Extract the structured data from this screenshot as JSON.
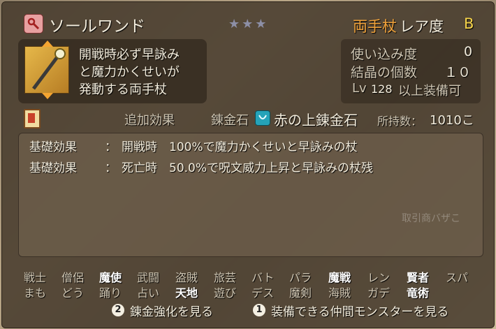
{
  "item": {
    "name": "ソールワンド",
    "stars": "★★★",
    "type": "両手杖",
    "rarity_label": "レア度",
    "rarity": "B",
    "description_lines": [
      "開戦時必ず早詠み",
      "と魔力かくせいが",
      "発動する両手杖"
    ]
  },
  "stats": {
    "usage_label": "使い込み度",
    "usage_value": "0",
    "crystal_label": "結晶の個数",
    "crystal_value": "１０",
    "lv_prefix": "Lv",
    "lv_value": "128",
    "lv_suffix": "以上装備可"
  },
  "extra": {
    "tab_label": "追加効果",
    "stone_label": "錬金石",
    "stone_name": "赤の上錬金石",
    "owned_label": "所持数：",
    "owned_value": "1010こ"
  },
  "effects": [
    {
      "label": "基礎効果",
      "sep": "：",
      "text": "開戦時　100%で魔力かくせいと早詠みの杖"
    },
    {
      "label": "基礎効果",
      "sep": "：",
      "text": "死亡時　50.0%で呪文威力上昇と早詠みの杖残"
    }
  ],
  "watermark": "取引商バザこ",
  "jobs": {
    "row1": [
      {
        "name": "戦士",
        "on": false
      },
      {
        "name": "僧侶",
        "on": false
      },
      {
        "name": "魔使",
        "on": true
      },
      {
        "name": "武闘",
        "on": false
      },
      {
        "name": "盗賊",
        "on": false
      },
      {
        "name": "旅芸",
        "on": false
      },
      {
        "name": "バト",
        "on": false
      },
      {
        "name": "パラ",
        "on": false
      },
      {
        "name": "魔戦",
        "on": true
      },
      {
        "name": "レン",
        "on": false
      },
      {
        "name": "賢者",
        "on": true
      },
      {
        "name": "スパ",
        "on": false
      }
    ],
    "row2": [
      {
        "name": "まも",
        "on": false
      },
      {
        "name": "どう",
        "on": false
      },
      {
        "name": "踊り",
        "on": false
      },
      {
        "name": "占い",
        "on": false
      },
      {
        "name": "天地",
        "on": true
      },
      {
        "name": "遊び",
        "on": false
      },
      {
        "name": "デス",
        "on": false
      },
      {
        "name": "魔剣",
        "on": false
      },
      {
        "name": "海賊",
        "on": false
      },
      {
        "name": "ガデ",
        "on": false
      },
      {
        "name": "竜術",
        "on": true
      }
    ]
  },
  "footer": {
    "btn2_key": "2",
    "btn2_label": "錬金強化を見る",
    "btn1_key": "1",
    "btn1_label": "装備できる仲間モンスターを見る"
  },
  "colors": {
    "accent": "#f0a23a",
    "rarity": "#f6d44a",
    "text": "#f2ecdc"
  }
}
